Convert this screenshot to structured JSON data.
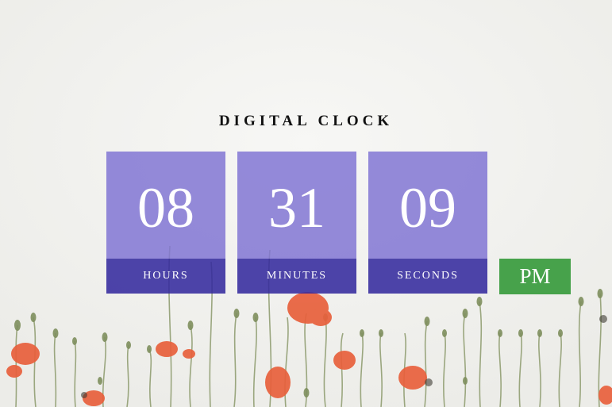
{
  "clock": {
    "title": "DIGITAL CLOCK",
    "hours": "08",
    "minutes": "31",
    "seconds": "09",
    "hours_label": "HOURS",
    "minutes_label": "MINUTES",
    "seconds_label": "SECONDS",
    "period": "PM"
  },
  "colors": {
    "digit_box": "#8f86d6",
    "label_bar": "#4639a4",
    "period_badge": "#47a24b",
    "title_text": "#111111"
  },
  "background": {
    "description_icon": "poppy-field-background"
  }
}
